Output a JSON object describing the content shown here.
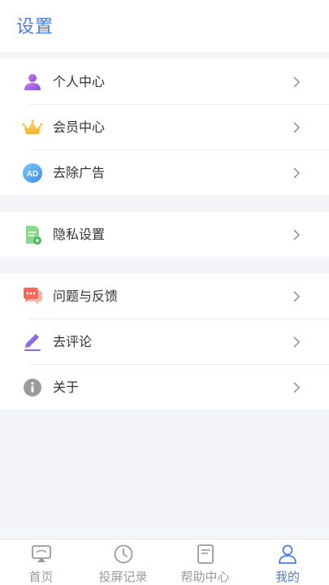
{
  "header": {
    "title": "设置"
  },
  "groups": [
    {
      "items": [
        {
          "label": "个人中心",
          "icon": "person-icon"
        },
        {
          "label": "会员中心",
          "icon": "crown-icon"
        },
        {
          "label": "去除广告",
          "icon": "ad-icon"
        }
      ]
    },
    {
      "items": [
        {
          "label": "隐私设置",
          "icon": "privacy-document-icon"
        }
      ]
    },
    {
      "items": [
        {
          "label": "问题与反馈",
          "icon": "chat-bubbles-icon"
        },
        {
          "label": "去评论",
          "icon": "pencil-icon"
        },
        {
          "label": "关于",
          "icon": "info-icon"
        }
      ]
    }
  ],
  "tabbar": {
    "tabs": [
      {
        "label": "首页",
        "icon": "screen-cast-icon",
        "active": false
      },
      {
        "label": "投屏记录",
        "icon": "clock-icon",
        "active": false
      },
      {
        "label": "帮助中心",
        "icon": "book-icon",
        "active": false
      },
      {
        "label": "我的",
        "icon": "user-profile-icon",
        "active": true
      }
    ]
  },
  "colors": {
    "accent": "#4a7ce6",
    "background": "#f4f5f9",
    "text": "#333333",
    "inactive_tab": "#9a9a9a"
  }
}
